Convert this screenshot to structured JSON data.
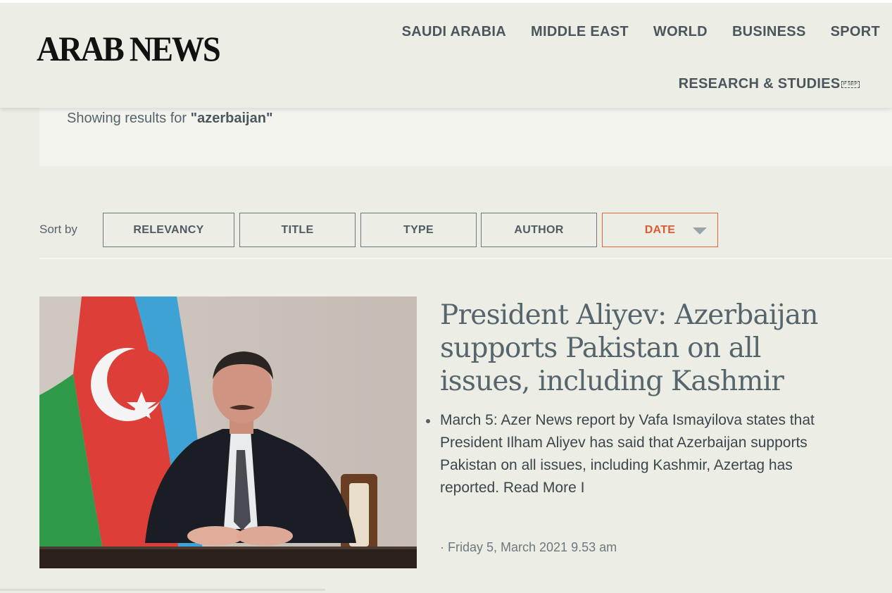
{
  "header": {
    "logo": "ARAB NEWS",
    "nav": [
      "SAUDI ARABIA",
      "MIDDLE EAST",
      "WORLD",
      "BUSINESS",
      "SPORT"
    ],
    "nav_secondary": "RESEARCH & STUDIES",
    "nav_secondary_glyph": "P SEP"
  },
  "search": {
    "prefix": "Showing results for ",
    "query": "\"azerbaijan\""
  },
  "sort": {
    "label": "Sort by",
    "options": [
      "RELEVANCY",
      "TITLE",
      "TYPE",
      "AUTHOR",
      "DATE"
    ],
    "active": "DATE",
    "active_color": "#dd5a32"
  },
  "article": {
    "title": "President Aliyev: Azerbaijan supports Pakistan on all issues, including Kashmir",
    "summary": "March 5: Azer News report by Vafa Ismayilova states that President Ilham Aliyev has said that Azerbaijan supports Pakistan on all issues, including Kashmir, Azertag has reported. Read More I",
    "date": "· Friday 5, March 2021 9.53 am"
  }
}
